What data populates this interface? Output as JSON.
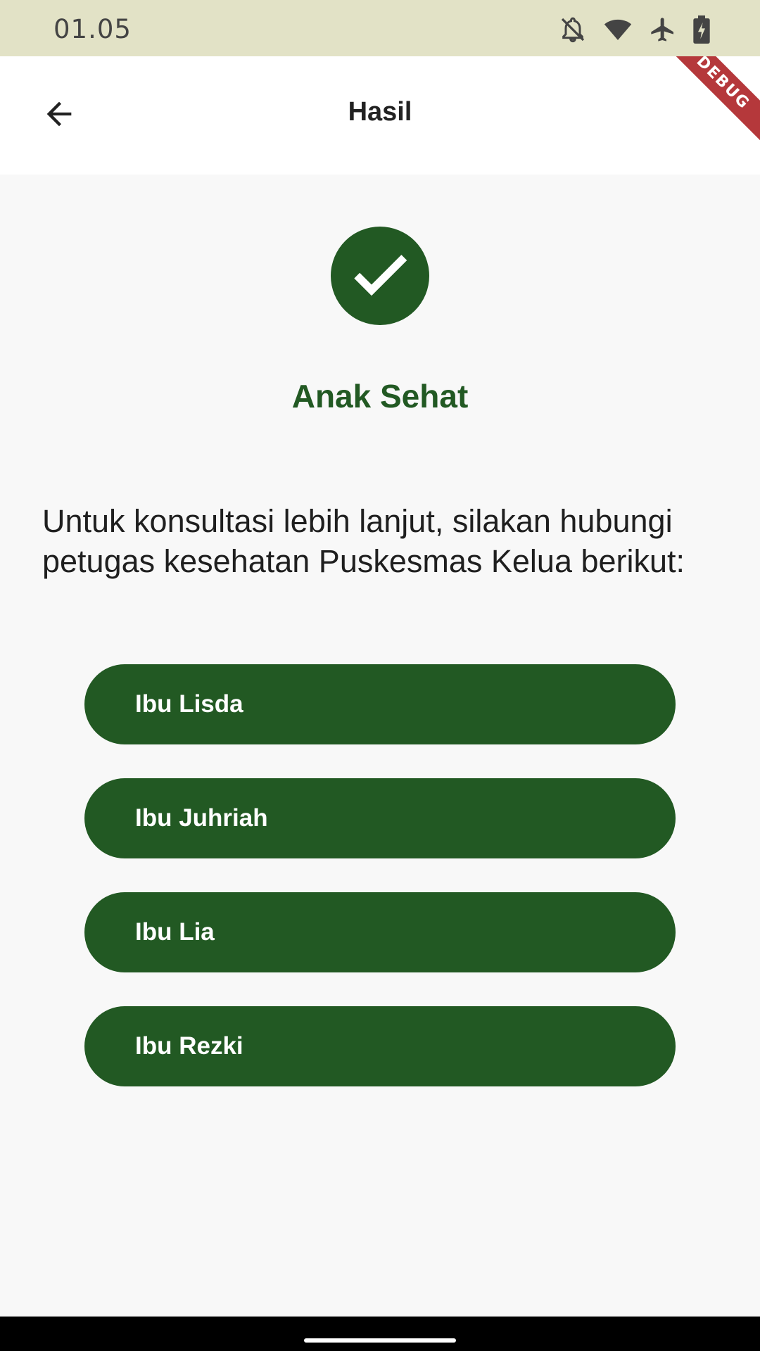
{
  "status_bar": {
    "time": "01.05",
    "icons": [
      "notifications-off-icon",
      "wifi-icon",
      "airplane-mode-icon",
      "battery-charging-icon"
    ]
  },
  "app_bar": {
    "back_icon": "arrow-left-icon",
    "title": "Hasil",
    "debug_banner": "DEBUG"
  },
  "result": {
    "icon": "check-icon",
    "title": "Anak Sehat",
    "message": "Untuk konsultasi lebih lanjut, silakan hubungi petugas kesehatan Puskesmas Kelua berikut:"
  },
  "contacts": [
    {
      "label": "Ibu Lisda"
    },
    {
      "label": "Ibu Juhriah"
    },
    {
      "label": "Ibu Lia"
    },
    {
      "label": "Ibu Rezki"
    }
  ],
  "colors": {
    "primary": "#225923",
    "status_bar": "#e2e2c6",
    "background": "#f8f8f8",
    "debug_banner": "#b5383b"
  }
}
